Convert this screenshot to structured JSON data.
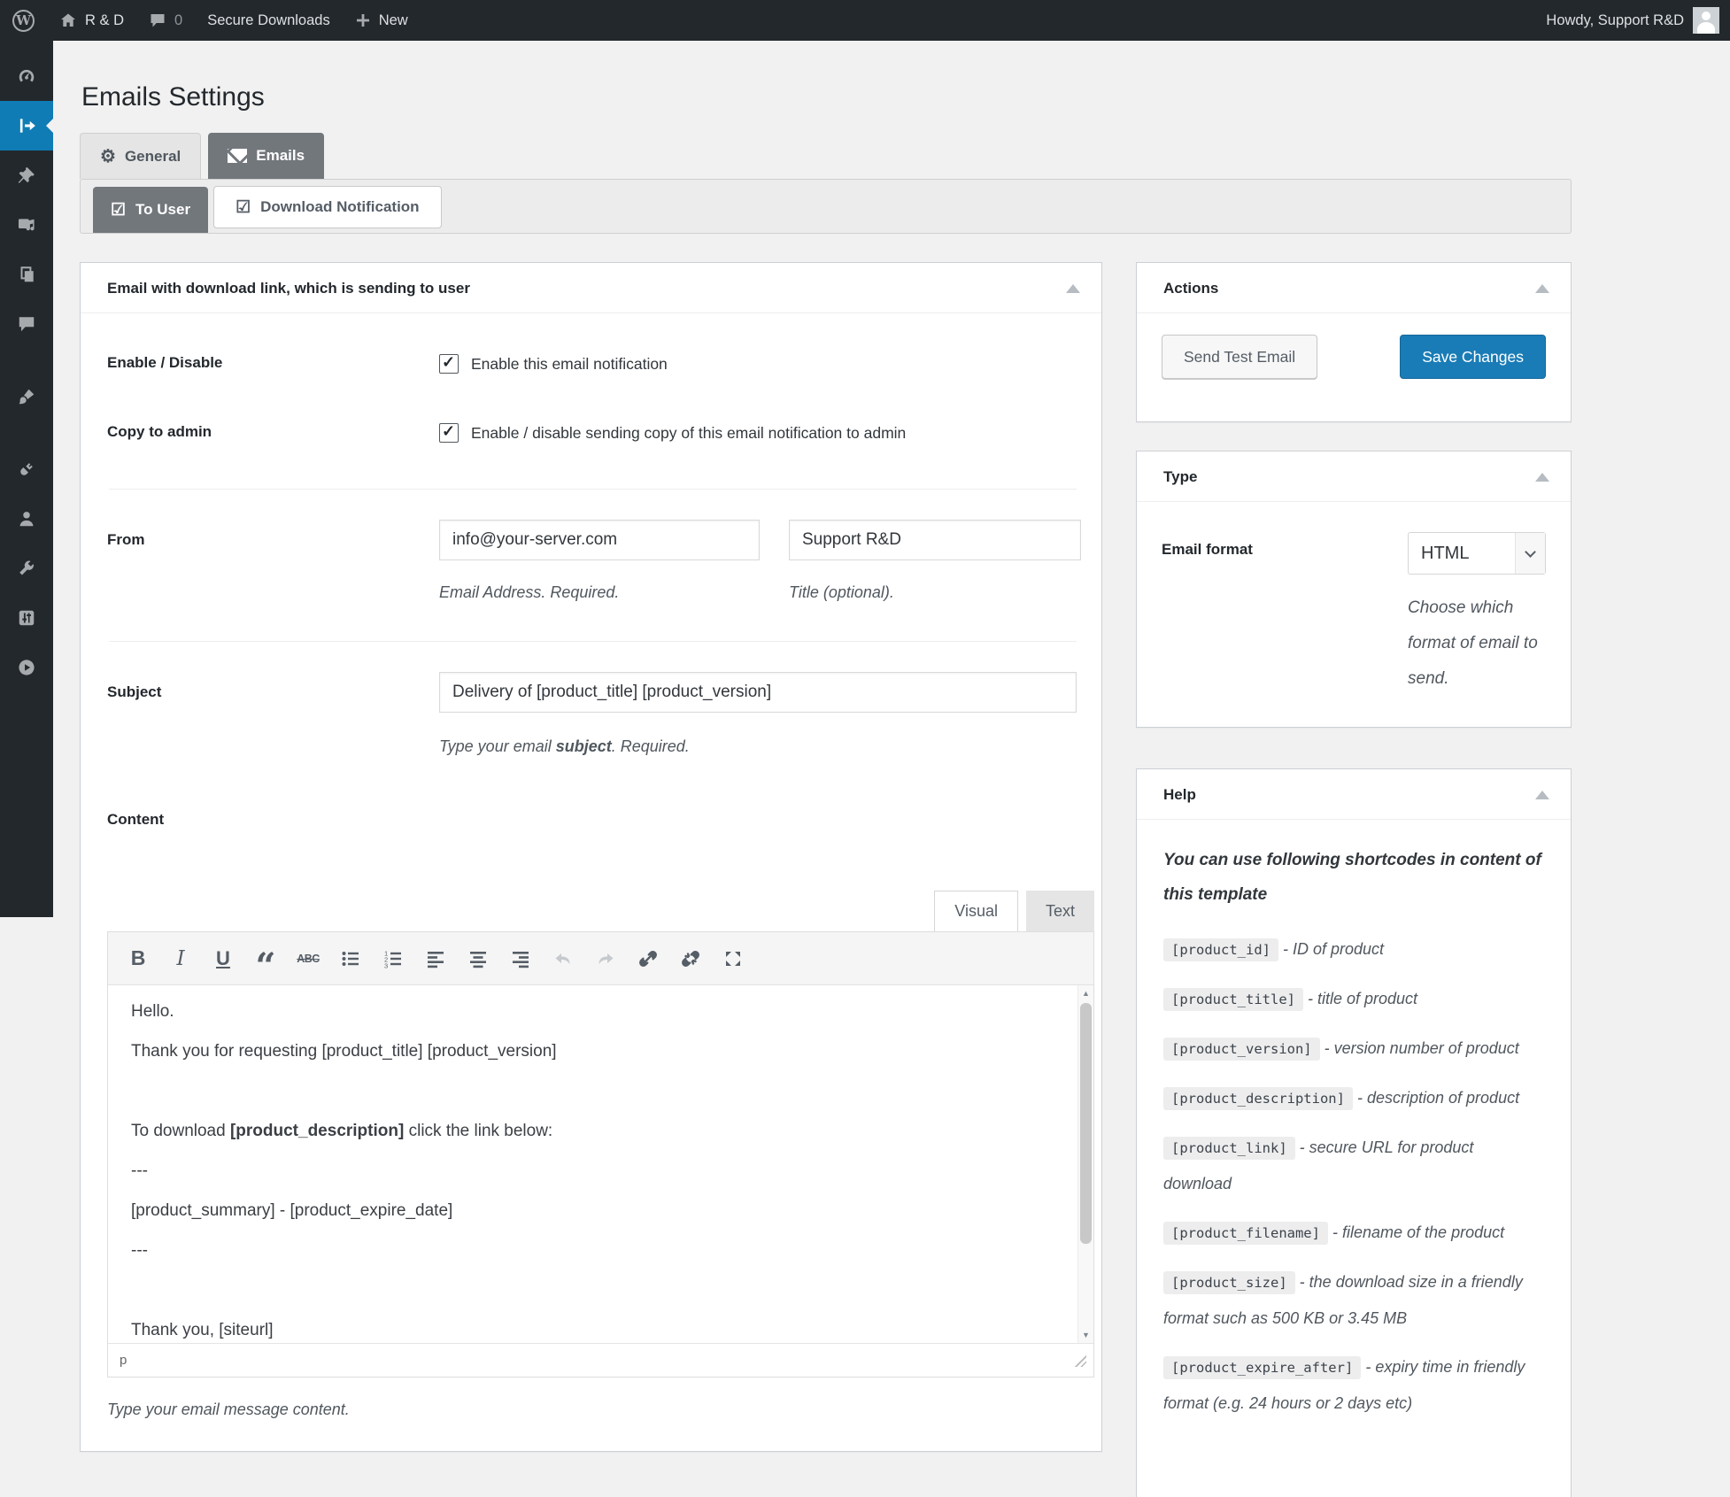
{
  "colors": {
    "adminbar_bg": "#23282d",
    "page_bg": "#f1f1f1",
    "active_menu_blue": "#0f7cb5",
    "active_tab_bg": "#72777c",
    "primary_button_bg": "#1a7cb6"
  },
  "admin_bar": {
    "icons": [
      "wordpress-logo",
      "home-icon",
      "comments-bubble-icon",
      "plus-icon"
    ],
    "site_name": "R & D",
    "comments_count": "0",
    "plugin_menu": "Secure Downloads",
    "new_menu": "New",
    "howdy": "Howdy, Support R&D"
  },
  "sidebar": {
    "items": [
      {
        "icon": "dashboard-icon"
      },
      {
        "icon": "secure-downloads-arrow-icon",
        "active": true
      },
      {
        "icon": "posts-pin-icon"
      },
      {
        "icon": "media-icon"
      },
      {
        "icon": "pages-icon"
      },
      {
        "icon": "comments-icon"
      },
      {
        "icon": "appearance-brush-icon"
      },
      {
        "icon": "plugins-plug-icon"
      },
      {
        "icon": "users-icon"
      },
      {
        "icon": "tools-wrench-icon"
      },
      {
        "icon": "settings-sliders-icon"
      },
      {
        "icon": "play-circle-icon"
      }
    ]
  },
  "page": {
    "title": "Emails Settings"
  },
  "tabs": {
    "general": "General",
    "emails": "Emails"
  },
  "subtabs": {
    "to_user": "To User",
    "download_notification": "Download Notification"
  },
  "form": {
    "panel_title": "Email with download link, which is sending to user",
    "enable": {
      "label": "Enable / Disable",
      "checkbox_label": "Enable this email notification",
      "checked": true
    },
    "copy": {
      "label": "Copy to admin",
      "checkbox_label": "Enable / disable sending copy of this email notification to admin",
      "checked": true
    },
    "from": {
      "label": "From",
      "email_value": "info@your-server.com",
      "title_value": "Support R&D",
      "email_help": "Email Address. Required.",
      "title_help": "Title (optional)."
    },
    "subject": {
      "label": "Subject",
      "value": "Delivery of [product_title] [product_version]",
      "help_pre": "Type your email ",
      "help_bold": "subject",
      "help_post": ". Required."
    },
    "content": {
      "label": "Content",
      "help": "Type your email message content."
    }
  },
  "editor": {
    "tabs": {
      "visual": "Visual",
      "text": "Text"
    },
    "toolbar": [
      "bold",
      "italic",
      "underline",
      "blockquote",
      "strikethrough",
      "bulleted-list",
      "numbered-list",
      "align-left",
      "align-center",
      "align-right",
      "undo",
      "redo",
      "link",
      "unlink",
      "fullscreen"
    ],
    "paragraphs": [
      {
        "pre": "Hello."
      },
      {
        "pre": "Thank you for requesting [product_title] [product_version]"
      },
      {
        "pre": ""
      },
      {
        "pre": "To download ",
        "bold": "[product_description]",
        "post": " click the link below:"
      },
      {
        "pre": "---"
      },
      {
        "pre": "[product_summary] - [product_expire_date]"
      },
      {
        "pre": "---"
      },
      {
        "pre": ""
      },
      {
        "pre": "Thank you, [siteurl]"
      }
    ],
    "path": "p"
  },
  "actions": {
    "title": "Actions",
    "send_test": "Send Test Email",
    "save": "Save Changes"
  },
  "type_panel": {
    "title": "Type",
    "label": "Email format",
    "value": "HTML",
    "help": "Choose which format of email to send."
  },
  "help_panel": {
    "title": "Help",
    "intro": "You can use following shortcodes in content of this template",
    "shortcodes": [
      {
        "code": "[product_id]",
        "desc": "- ID of product"
      },
      {
        "code": "[product_title]",
        "desc": "- title of product"
      },
      {
        "code": "[product_version]",
        "desc": "- version number of product"
      },
      {
        "code": "[product_description]",
        "desc": "- description of product"
      },
      {
        "code": "[product_link]",
        "desc": "- secure URL for product download"
      },
      {
        "code": "[product_filename]",
        "desc": "- filename of the product"
      },
      {
        "code": "[product_size]",
        "desc": "- the download size in a friendly format such as 500 KB or 3.45 MB"
      },
      {
        "code": "[product_expire_after]",
        "desc": "- expiry time in friendly format (e.g. 24 hours or 2 days etc)"
      }
    ]
  }
}
